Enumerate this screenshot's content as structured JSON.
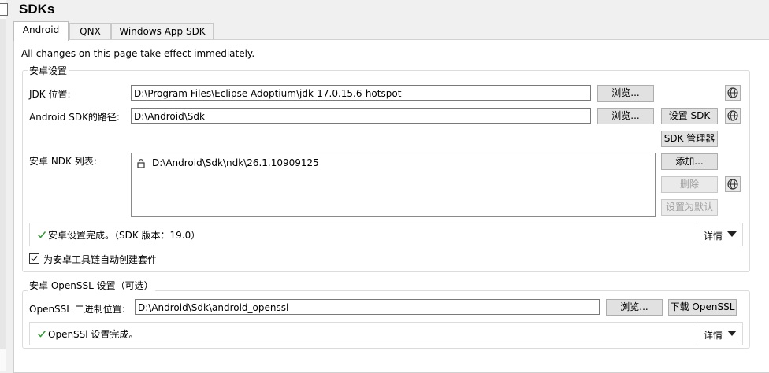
{
  "page": {
    "title": "SDKs"
  },
  "tabs": [
    {
      "label": "Android",
      "active": true
    },
    {
      "label": "QNX",
      "active": false
    },
    {
      "label": "Windows App SDK",
      "active": false
    }
  ],
  "notice": "All changes on this page take effect immediately.",
  "android": {
    "group_title": "安卓设置",
    "jdk": {
      "label": "JDK 位置:",
      "value": "D:\\Program Files\\Eclipse Adoptium\\jdk-17.0.15.6-hotspot",
      "browse": "浏览..."
    },
    "sdk": {
      "label": "Android SDK的路径:",
      "value": "D:\\Android\\Sdk",
      "browse": "浏览...",
      "setup": "设置 SDK",
      "manager": "SDK 管理器"
    },
    "ndk": {
      "label": "安卓 NDK 列表:",
      "items": [
        {
          "path": "D:\\Android\\Sdk\\ndk\\26.1.10909125",
          "locked": true
        }
      ],
      "add": "添加...",
      "remove": "删除",
      "set_default": "设置为默认"
    },
    "status": {
      "text": "安卓设置完成。（SDK 版本：19.0）",
      "details": "详情"
    },
    "auto_kits": {
      "label": "为安卓工具链自动创建套件",
      "checked": true
    }
  },
  "openssl": {
    "group_title": "安卓 OpenSSL 设置（可选）",
    "label": "OpenSSL 二进制位置:",
    "value": "D:\\Android\\Sdk\\android_openssl",
    "browse": "浏览...",
    "download": "下载 OpenSSL",
    "status": {
      "text": "OpenSSl 设置完成。",
      "details": "详情"
    }
  },
  "icons": {
    "globe": "globe-icon",
    "lock": "lock-icon",
    "check": "check-icon",
    "caret": "caret-down-icon"
  }
}
